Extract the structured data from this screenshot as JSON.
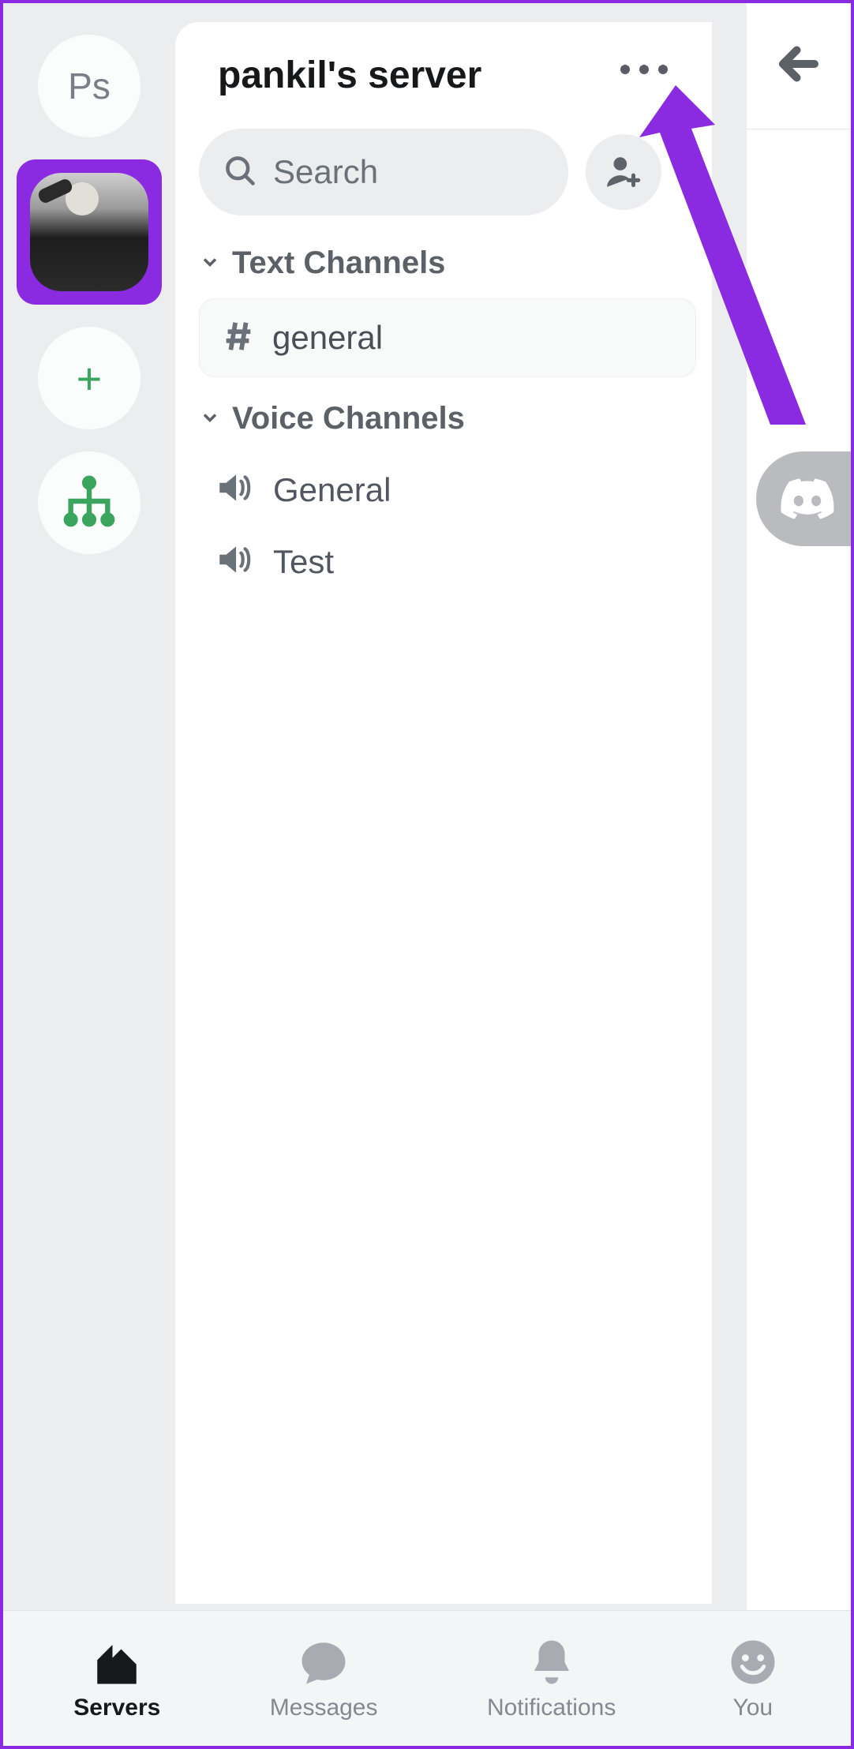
{
  "server_rail": {
    "ps_label": "Ps"
  },
  "header": {
    "server_title": "pankil's server"
  },
  "search": {
    "placeholder": "Search"
  },
  "sections": {
    "text_channels_label": "Text Channels",
    "voice_channels_label": "Voice Channels"
  },
  "text_channels": [
    {
      "name": "general"
    }
  ],
  "voice_channels": [
    {
      "name": "General"
    },
    {
      "name": "Test"
    }
  ],
  "tabs": {
    "servers": "Servers",
    "messages": "Messages",
    "notifications": "Notifications",
    "you": "You"
  }
}
